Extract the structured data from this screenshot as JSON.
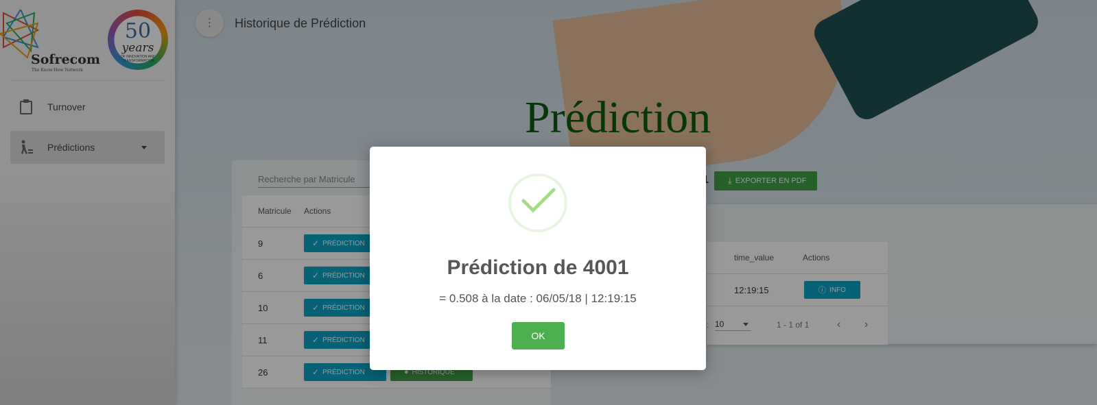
{
  "page": {
    "title": "Historique de Prédiction",
    "hero_title": "Prédiction"
  },
  "brand": {
    "name": "Sofrecom",
    "tagline": "The Know-How Network",
    "anniversary_number": "50",
    "anniversary_word": "years",
    "anniversary_sub": "OF INNOVATION AND TRANSFORMATION"
  },
  "sidebar": {
    "items": [
      {
        "label": "Turnover",
        "icon": "clipboard-icon"
      },
      {
        "label": "Prédictions",
        "icon": "person-chart-icon",
        "expanded": false
      }
    ]
  },
  "search": {
    "placeholder": "Recherche par Matricule"
  },
  "left_table": {
    "headers": [
      "Matricule",
      "Actions"
    ],
    "rows": [
      {
        "matricule": "9"
      },
      {
        "matricule": "6"
      },
      {
        "matricule": "10"
      },
      {
        "matricule": "11"
      },
      {
        "matricule": "26"
      }
    ],
    "prediction_label": "PRÉDICTION",
    "historique_label": "HISTORIQUE"
  },
  "right_panel": {
    "count_partial": "1",
    "export_label": "EXPORTER EN PDF",
    "headers": [
      "time_value",
      "Actions"
    ],
    "rows": [
      {
        "time_value": "12:19:15",
        "action": "INFO"
      }
    ],
    "pager": {
      "rows_per_page_suffix": ":",
      "rows_per_page": "10",
      "range": "1 - 1 of 1"
    }
  },
  "modal": {
    "title": "Prédiction de 4001",
    "text": "= 0.508 à la date : 06/05/18 | 12:19:15",
    "ok_label": "OK",
    "success_color": "#a5dc86"
  }
}
